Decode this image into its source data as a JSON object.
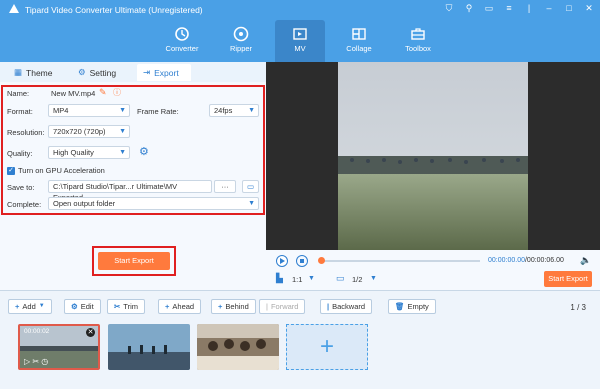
{
  "window": {
    "title": "Tipard Video Converter Ultimate (Unregistered)"
  },
  "nav": {
    "items": [
      "Converter",
      "Ripper",
      "MV",
      "Collage",
      "Toolbox"
    ],
    "active": "MV"
  },
  "tabs": {
    "theme": "Theme",
    "setting": "Setting",
    "export": "Export"
  },
  "export_form": {
    "name_label": "Name:",
    "name_value": "New MV.mp4",
    "format_label": "Format:",
    "format_value": "MP4",
    "frame_rate_label": "Frame Rate:",
    "frame_rate_value": "24fps",
    "resolution_label": "Resolution:",
    "resolution_value": "720x720 (720p)",
    "quality_label": "Quality:",
    "quality_value": "High Quality",
    "gpu_label": "Turn on GPU Acceleration",
    "save_to_label": "Save to:",
    "save_to_value": "C:\\Tipard Studio\\Tipar...r Ultimate\\MV Exported",
    "save_more": "···",
    "complete_label": "Complete:",
    "complete_value": "Open output folder"
  },
  "start_export": "Start Export",
  "player": {
    "time_current": "00:00:00.00",
    "time_total": "/00:00:06.00",
    "aspect": "1:1",
    "page": "1/2",
    "export": "Start Export"
  },
  "toolbar": {
    "add": "Add",
    "edit": "Edit",
    "trim": "Trim",
    "ahead": "Ahead",
    "behind": "Behind",
    "forward": "Forward",
    "backward": "Backward",
    "empty": "Empty"
  },
  "pager": "1 / 3",
  "clip": {
    "time": "00:00:02"
  },
  "colors": {
    "accent": "#4aa0e6",
    "orange": "#ff7a3d",
    "red_highlight": "#e02020"
  }
}
